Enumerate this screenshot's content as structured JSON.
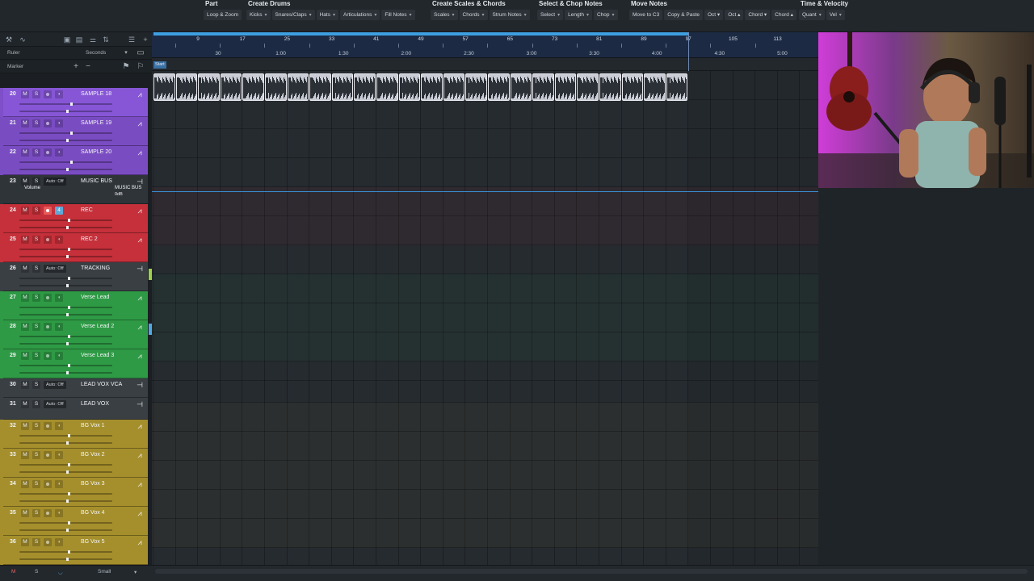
{
  "toolbar": {
    "groups": [
      {
        "title": "Part",
        "buttons": [
          "Loop & Zoom"
        ]
      },
      {
        "title": "Create Drums",
        "buttons": [
          "Kicks",
          "Snares/Claps",
          "Hats",
          "Articulations",
          "Fill Notes"
        ]
      },
      {
        "title": "Create Scales & Chords",
        "buttons": [
          "Scales",
          "Chords",
          "Strum Notes"
        ]
      },
      {
        "title": "Select & Chop Notes",
        "buttons": [
          "Select",
          "Length",
          "Chop"
        ]
      },
      {
        "title": "Move Notes",
        "buttons": [
          "Move to C3",
          "Copy & Paste",
          "Oct ▾",
          "Oct ▴",
          "Chord ▾",
          "Chord ▴"
        ]
      },
      {
        "title": "Time & Velocity",
        "buttons": [
          "Quant",
          "Vel"
        ]
      }
    ]
  },
  "left_panel": {
    "ruler_label": "Ruler",
    "ruler_value": "Seconds",
    "marker_label": "Marker"
  },
  "tracks": [
    {
      "num": "20",
      "name": "SAMPLE 18",
      "color": "#7f4fc9",
      "selected": true,
      "fader": 0.55
    },
    {
      "num": "21",
      "name": "SAMPLE 19",
      "color": "#7a4cc2",
      "fader": 0.55
    },
    {
      "num": "22",
      "name": "SAMPLE 20",
      "color": "#7a4cc2",
      "fader": 0.55
    },
    {
      "num": "23",
      "name": "MUSIC BUS",
      "color": "#2f3439",
      "auto": "Auto: Off",
      "sub_label": "Volume",
      "sub_value": "MUSIC BUS",
      "sub_db": "0dB"
    },
    {
      "num": "24",
      "name": "REC",
      "color": "#c5303a",
      "armed": true,
      "monitor": "4",
      "fader": 0.52
    },
    {
      "num": "25",
      "name": "REC 2",
      "color": "#c5303a",
      "fader": 0.52
    },
    {
      "num": "26",
      "name": "TRACKING",
      "color": "#3a3f44",
      "auto": "Auto: Off",
      "fader": 0.52
    },
    {
      "num": "27",
      "name": "Verse Lead",
      "color": "#2e9a45",
      "fader": 0.52
    },
    {
      "num": "28",
      "name": "Verse Lead 2",
      "color": "#2e9a45",
      "fader": 0.52
    },
    {
      "num": "29",
      "name": "Verse Lead 3",
      "color": "#2e9a45",
      "fader": 0.52
    },
    {
      "num": "30",
      "name": "LEAD VOX VCA",
      "color": "#3a3f44",
      "auto": "Auto: Off"
    },
    {
      "num": "31",
      "name": "LEAD VOX",
      "color": "#3a3f44",
      "auto": "Auto: Off"
    },
    {
      "num": "32",
      "name": "BG Vox 1",
      "color": "#a58f2c",
      "fader": 0.52
    },
    {
      "num": "33",
      "name": "BG Vox 2",
      "color": "#a58f2c",
      "fader": 0.52
    },
    {
      "num": "34",
      "name": "BG Vox 3",
      "color": "#a58f2c",
      "fader": 0.52
    },
    {
      "num": "35",
      "name": "BG Vox 4",
      "color": "#a58f2c",
      "fader": 0.52
    },
    {
      "num": "36",
      "name": "BG Vox 5",
      "color": "#a58f2c",
      "fader": 0.52
    }
  ],
  "ruler": {
    "bars": [
      "9",
      "17",
      "25",
      "33",
      "41",
      "49",
      "57",
      "65",
      "73",
      "81",
      "89",
      "97",
      "105",
      "113"
    ],
    "times": [
      "30",
      "1:00",
      "1:30",
      "2:00",
      "2:30",
      "3:00",
      "3:30",
      "4:00",
      "4:30",
      "5:00"
    ],
    "start_marker": "Start"
  },
  "clips": {
    "track": "SAMPLE 18",
    "count": 24
  },
  "bottom": {
    "m_label": "M",
    "s_label": "S",
    "size_label": "Small"
  },
  "colors": {
    "accent": "#3e9fe0",
    "ruler_bg": "#1c2a44",
    "arrange_bg": "#262b30"
  }
}
